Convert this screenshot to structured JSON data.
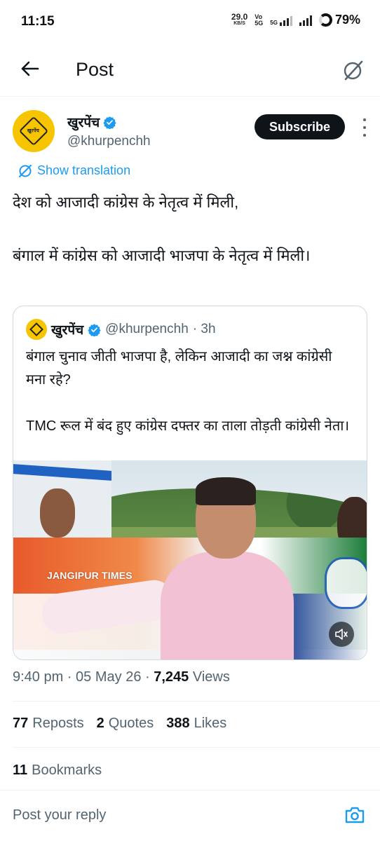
{
  "status_bar": {
    "time": "11:15",
    "speed_value": "29.0",
    "speed_unit": "KB/S",
    "volte": "Vo\n5G",
    "network": "5G",
    "battery": "79%"
  },
  "header": {
    "title": "Post"
  },
  "author": {
    "name": "खुरपेंच",
    "handle": "@khurpenchh",
    "subscribe_label": "Subscribe",
    "avatar_text": "खुरपेंच"
  },
  "translation": {
    "label": "Show translation"
  },
  "tweet": {
    "line1": "देश को आजादी कांग्रेस के नेतृत्व में मिली,",
    "line2": "बंगाल में कांग्रेस को आजादी भाजपा के नेतृत्व में मिली।"
  },
  "quote": {
    "name": "खुरपेंच",
    "handle": "@khurpenchh",
    "time": "· 3h",
    "text1": "बंगाल चुनाव जीती भाजपा है, लेकिन आजादी का जश्न कांग्रेसी मना रहे?",
    "text2": "TMC रूल में बंद हुए कांग्रेस दफ्तर का ताला तोड़ती कांग्रेसी नेता।",
    "media_watermark": "JANGIPUR TIMES"
  },
  "meta": {
    "time": "9:40 pm",
    "date": "05 May 26",
    "views_count": "7,245",
    "views_label": "Views"
  },
  "stats": {
    "reposts_count": "77",
    "reposts_label": "Reposts",
    "quotes_count": "2",
    "quotes_label": "Quotes",
    "likes_count": "388",
    "likes_label": "Likes",
    "bookmarks_count": "11",
    "bookmarks_label": "Bookmarks"
  },
  "reply": {
    "placeholder": "Post your reply"
  },
  "colors": {
    "accent": "#1d9bf0",
    "text_primary": "#0f1419",
    "text_secondary": "#536471",
    "avatar_yellow": "#f7c400"
  },
  "icons": [
    "back-arrow-icon",
    "grok-icon",
    "verified-badge-icon",
    "more-vertical-icon",
    "translate-icon",
    "mute-icon",
    "camera-icon"
  ]
}
